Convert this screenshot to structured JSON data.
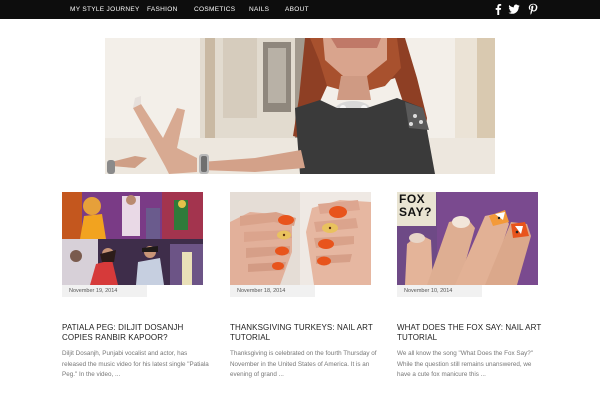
{
  "nav": {
    "items": [
      {
        "label": "MY STYLE JOURNEY"
      },
      {
        "label": "FASHION"
      },
      {
        "label": "COSMETICS"
      },
      {
        "label": "NAILS"
      },
      {
        "label": "ABOUT"
      }
    ],
    "social": [
      {
        "icon": "facebook-icon"
      },
      {
        "icon": "twitter-icon"
      },
      {
        "icon": "pinterest-icon"
      }
    ]
  },
  "posts": [
    {
      "date": "November 19, 2014",
      "title": "PATIALA PEG: DILJIT DOSANJH COPIES RANBIR KAPOOR?",
      "excerpt": "Diljit Dosanjh, Punjabi vocalist and actor, has released the music video for his latest single \"Patiala Peg.\" In the video, ..."
    },
    {
      "date": "November 18, 2014",
      "title": "THANKSGIVING TURKEYS: NAIL ART TUTORIAL",
      "excerpt": "Thanksgiving is celebrated on the fourth Thursday of November in the United States of America. It is an evening of grand ..."
    },
    {
      "date": "November 10, 2014",
      "title": "WHAT DOES THE FOX SAY: NAIL ART TUTORIAL",
      "excerpt": "We all know the song \"What Does the Fox Say?\" While the question still remains unanswered, we have a cute fox manicure this ...",
      "thumb_caption": [
        "FOX",
        "SAY?"
      ]
    }
  ],
  "colors": {
    "nav_background": "#0d0d0d",
    "nav_text": "#ffffff",
    "date_badge_background": "#f1f1f1",
    "title_text": "#222222",
    "excerpt_text": "#777777",
    "nail_orange": "#e8541c"
  }
}
